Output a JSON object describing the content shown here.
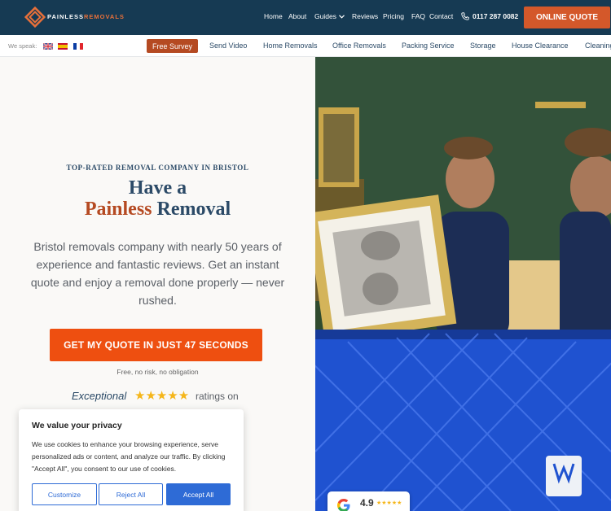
{
  "header": {
    "logo_text_a": "PAINLESS",
    "logo_text_b": "REMOVALS",
    "nav": [
      "Home",
      "About",
      "Guides",
      "Reviews",
      "Pricing",
      "FAQ",
      "Contact"
    ],
    "phone": "0117 287 0082",
    "cta": "ONLINE QUOTE"
  },
  "subnav": {
    "we_speak": "We speak:",
    "active": "Free Survey",
    "items": [
      "Send Video",
      "Home Removals",
      "Office Removals",
      "Packing Service",
      "Storage",
      "House Clearance",
      "Cleaning"
    ]
  },
  "hero": {
    "eyebrow": "TOP-RATED REMOVAL COMPANY IN BRISTOL",
    "h1_line1": "Have a",
    "h1_orange": "Painless",
    "h1_blue": "Removal",
    "lead": "Bristol removals company with nearly 50 years of experience and fantastic reviews. Get an instant quote and enjoy a removal done properly — never rushed.",
    "cta": "GET MY QUOTE IN JUST 47 SECONDS",
    "cta_sub": "Free, no risk, no obligation",
    "rating_word": "Exceptional",
    "stars": "★★★★★",
    "ratings_on": "ratings on"
  },
  "google_badge": {
    "score": "4.9",
    "stars": "★★★★★"
  },
  "cookie": {
    "title": "We value your privacy",
    "text": "We use cookies to enhance your browsing experience, serve personalized ads or content, and analyze our traffic. By clicking \"Accept All\", you consent to our use of cookies.",
    "customize": "Customize",
    "reject": "Reject All",
    "accept": "Accept All"
  },
  "colors": {
    "navy": "#163a53",
    "brand_orange": "#d4582a",
    "cta_orange": "#ee4f10",
    "accept_blue": "#2e6bd6"
  },
  "icons": [
    "painless-removals-logo",
    "chevron-down-icon",
    "phone-icon",
    "flag-uk-icon",
    "flag-spain-icon",
    "flag-france-icon",
    "star-icon",
    "google-icon"
  ]
}
